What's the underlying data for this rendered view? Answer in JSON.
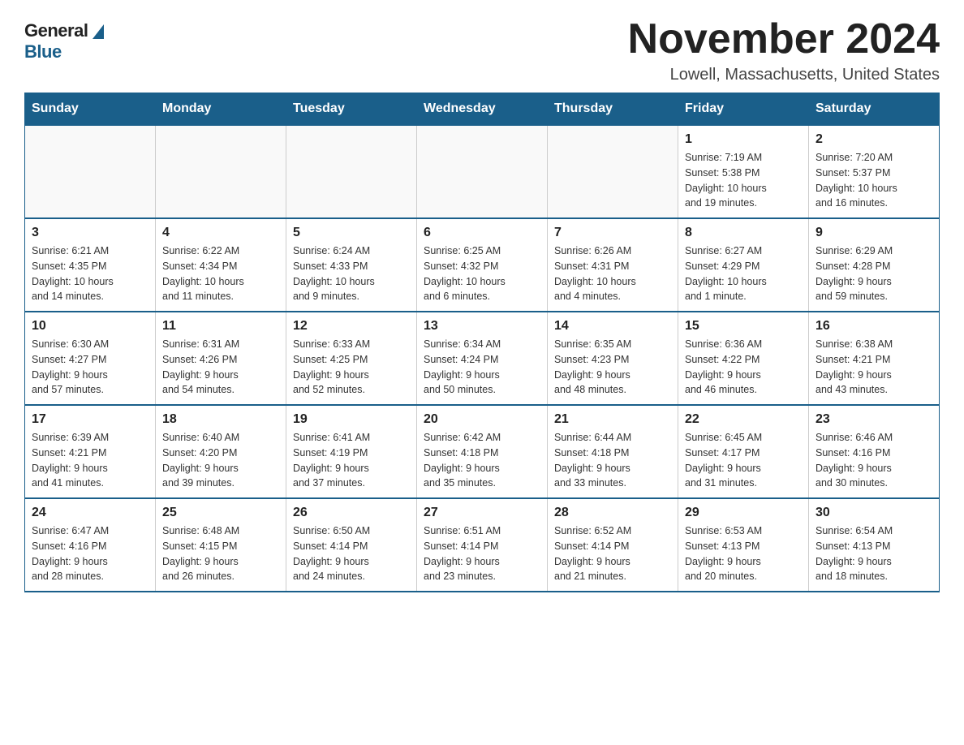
{
  "logo": {
    "general": "General",
    "blue": "Blue"
  },
  "title": "November 2024",
  "subtitle": "Lowell, Massachusetts, United States",
  "days_of_week": [
    "Sunday",
    "Monday",
    "Tuesday",
    "Wednesday",
    "Thursday",
    "Friday",
    "Saturday"
  ],
  "weeks": [
    [
      {
        "day": "",
        "info": ""
      },
      {
        "day": "",
        "info": ""
      },
      {
        "day": "",
        "info": ""
      },
      {
        "day": "",
        "info": ""
      },
      {
        "day": "",
        "info": ""
      },
      {
        "day": "1",
        "info": "Sunrise: 7:19 AM\nSunset: 5:38 PM\nDaylight: 10 hours\nand 19 minutes."
      },
      {
        "day": "2",
        "info": "Sunrise: 7:20 AM\nSunset: 5:37 PM\nDaylight: 10 hours\nand 16 minutes."
      }
    ],
    [
      {
        "day": "3",
        "info": "Sunrise: 6:21 AM\nSunset: 4:35 PM\nDaylight: 10 hours\nand 14 minutes."
      },
      {
        "day": "4",
        "info": "Sunrise: 6:22 AM\nSunset: 4:34 PM\nDaylight: 10 hours\nand 11 minutes."
      },
      {
        "day": "5",
        "info": "Sunrise: 6:24 AM\nSunset: 4:33 PM\nDaylight: 10 hours\nand 9 minutes."
      },
      {
        "day": "6",
        "info": "Sunrise: 6:25 AM\nSunset: 4:32 PM\nDaylight: 10 hours\nand 6 minutes."
      },
      {
        "day": "7",
        "info": "Sunrise: 6:26 AM\nSunset: 4:31 PM\nDaylight: 10 hours\nand 4 minutes."
      },
      {
        "day": "8",
        "info": "Sunrise: 6:27 AM\nSunset: 4:29 PM\nDaylight: 10 hours\nand 1 minute."
      },
      {
        "day": "9",
        "info": "Sunrise: 6:29 AM\nSunset: 4:28 PM\nDaylight: 9 hours\nand 59 minutes."
      }
    ],
    [
      {
        "day": "10",
        "info": "Sunrise: 6:30 AM\nSunset: 4:27 PM\nDaylight: 9 hours\nand 57 minutes."
      },
      {
        "day": "11",
        "info": "Sunrise: 6:31 AM\nSunset: 4:26 PM\nDaylight: 9 hours\nand 54 minutes."
      },
      {
        "day": "12",
        "info": "Sunrise: 6:33 AM\nSunset: 4:25 PM\nDaylight: 9 hours\nand 52 minutes."
      },
      {
        "day": "13",
        "info": "Sunrise: 6:34 AM\nSunset: 4:24 PM\nDaylight: 9 hours\nand 50 minutes."
      },
      {
        "day": "14",
        "info": "Sunrise: 6:35 AM\nSunset: 4:23 PM\nDaylight: 9 hours\nand 48 minutes."
      },
      {
        "day": "15",
        "info": "Sunrise: 6:36 AM\nSunset: 4:22 PM\nDaylight: 9 hours\nand 46 minutes."
      },
      {
        "day": "16",
        "info": "Sunrise: 6:38 AM\nSunset: 4:21 PM\nDaylight: 9 hours\nand 43 minutes."
      }
    ],
    [
      {
        "day": "17",
        "info": "Sunrise: 6:39 AM\nSunset: 4:21 PM\nDaylight: 9 hours\nand 41 minutes."
      },
      {
        "day": "18",
        "info": "Sunrise: 6:40 AM\nSunset: 4:20 PM\nDaylight: 9 hours\nand 39 minutes."
      },
      {
        "day": "19",
        "info": "Sunrise: 6:41 AM\nSunset: 4:19 PM\nDaylight: 9 hours\nand 37 minutes."
      },
      {
        "day": "20",
        "info": "Sunrise: 6:42 AM\nSunset: 4:18 PM\nDaylight: 9 hours\nand 35 minutes."
      },
      {
        "day": "21",
        "info": "Sunrise: 6:44 AM\nSunset: 4:18 PM\nDaylight: 9 hours\nand 33 minutes."
      },
      {
        "day": "22",
        "info": "Sunrise: 6:45 AM\nSunset: 4:17 PM\nDaylight: 9 hours\nand 31 minutes."
      },
      {
        "day": "23",
        "info": "Sunrise: 6:46 AM\nSunset: 4:16 PM\nDaylight: 9 hours\nand 30 minutes."
      }
    ],
    [
      {
        "day": "24",
        "info": "Sunrise: 6:47 AM\nSunset: 4:16 PM\nDaylight: 9 hours\nand 28 minutes."
      },
      {
        "day": "25",
        "info": "Sunrise: 6:48 AM\nSunset: 4:15 PM\nDaylight: 9 hours\nand 26 minutes."
      },
      {
        "day": "26",
        "info": "Sunrise: 6:50 AM\nSunset: 4:14 PM\nDaylight: 9 hours\nand 24 minutes."
      },
      {
        "day": "27",
        "info": "Sunrise: 6:51 AM\nSunset: 4:14 PM\nDaylight: 9 hours\nand 23 minutes."
      },
      {
        "day": "28",
        "info": "Sunrise: 6:52 AM\nSunset: 4:14 PM\nDaylight: 9 hours\nand 21 minutes."
      },
      {
        "day": "29",
        "info": "Sunrise: 6:53 AM\nSunset: 4:13 PM\nDaylight: 9 hours\nand 20 minutes."
      },
      {
        "day": "30",
        "info": "Sunrise: 6:54 AM\nSunset: 4:13 PM\nDaylight: 9 hours\nand 18 minutes."
      }
    ]
  ]
}
